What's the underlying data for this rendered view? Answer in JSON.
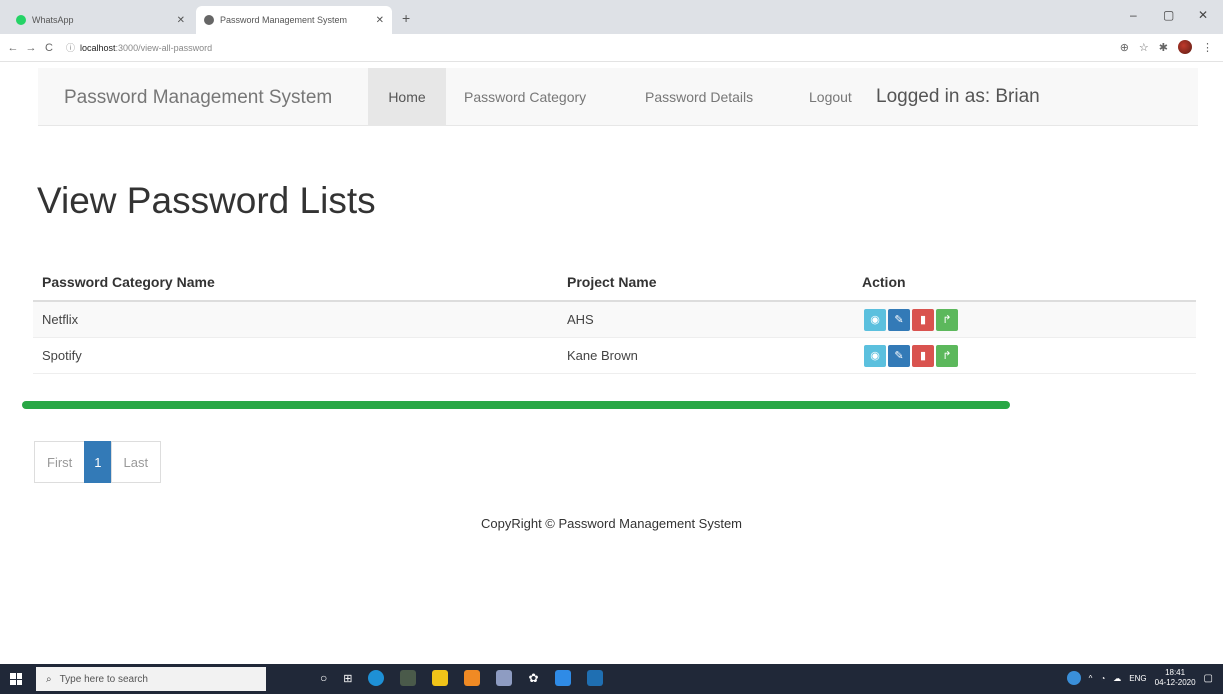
{
  "browser": {
    "tabs": [
      {
        "label": "WhatsApp",
        "favicon_color": "#25d366"
      },
      {
        "label": "Password Management System",
        "favicon_color": "#555555"
      }
    ],
    "new_tab": "+",
    "url_host": "localhost",
    "url_path": ":3000/view-all-password",
    "window": {
      "minimize": "–",
      "maximize": "▢",
      "close": "✕"
    }
  },
  "navbar": {
    "brand": "Password Management System",
    "items": [
      "Home",
      "Password Category",
      "Password Details",
      "Logout"
    ],
    "logged_in": "Logged in as: Brian"
  },
  "main": {
    "title": "View Password Lists",
    "columns": [
      "Password Category Name",
      "Project Name",
      "Action"
    ],
    "rows": [
      {
        "category": "Netflix",
        "project": "AHS"
      },
      {
        "category": "Spotify",
        "project": "Kane Brown"
      }
    ],
    "action_icons": [
      "eye-icon",
      "edit-icon",
      "trash-icon",
      "share-icon"
    ],
    "action_colors": [
      "#5bc0de",
      "#337ab7",
      "#d9534f",
      "#5cb85c"
    ]
  },
  "pagination": {
    "first": "First",
    "page": "1",
    "last": "Last"
  },
  "footer": "CopyRight © Password Management System",
  "taskbar": {
    "search_placeholder": "Type here to search",
    "language": "ENG",
    "time": "18:41",
    "date": "04-12-2020"
  },
  "colors": {
    "progress": "#28a745",
    "primary": "#337ab7"
  }
}
